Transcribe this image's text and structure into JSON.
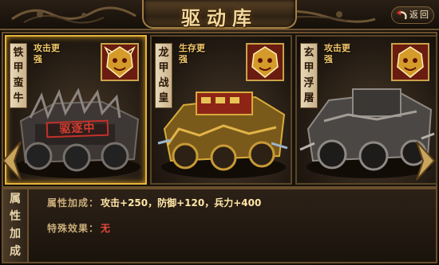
{
  "header": {
    "title": "驱动库",
    "back_label": "返回"
  },
  "vehicles": [
    {
      "name_chars": [
        "铁",
        "甲",
        "蛮",
        "牛"
      ],
      "bonus": "攻击更强",
      "stamp": "驱逐中",
      "selected": true
    },
    {
      "name_chars": [
        "龙",
        "甲",
        "战",
        "皇"
      ],
      "bonus": "生存更强",
      "selected": false
    },
    {
      "name_chars": [
        "玄",
        "甲",
        "浮",
        "屠"
      ],
      "bonus": "攻击更强",
      "selected": false
    }
  ],
  "attributes": {
    "tab_chars": [
      "属",
      "性",
      "加",
      "成"
    ],
    "bonus_label": "属性加成：",
    "bonus_value": "攻击+250，防御+120，兵力+400",
    "special_label": "特殊效果：",
    "special_value": "无"
  },
  "icons": {
    "back": "back-arrow-icon",
    "prev": "chevron-left-icon",
    "next": "chevron-right-icon",
    "emblem": "tiger-emblem-icon"
  },
  "colors": {
    "gold": "#f1c667",
    "selected_border": "#e6b43a",
    "none_red": "#e64a3c"
  }
}
